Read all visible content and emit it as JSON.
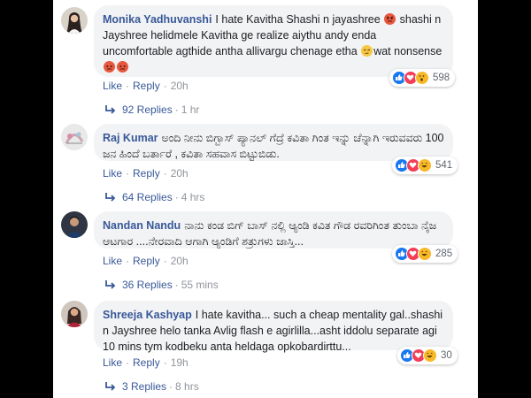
{
  "comments": [
    {
      "author": "Monika Yadhuvanshi",
      "text_parts": [
        "I hate Kavitha Shashi n jayashree",
        " shashi n Jayshree helidmele Kavitha ge realize aiythu andy enda uncomfortable agthide antha allivargu chenage etha",
        "wat nonsense"
      ],
      "like_label": "Like",
      "reply_label": "Reply",
      "time": "20h",
      "reaction_count": "598",
      "replies_label": "92 Replies",
      "replies_time": "1 hr"
    },
    {
      "author": "Raj Kumar",
      "text": "ಅಂದಿ ನೀನು ಬಿಗ್ಬಾಸ್ ಪ್ಯಾನಲ್ ಗೆದ್ರೆ ಕವಿತಾ ಗಿಂತ ಇನ್ನು ಚೆನ್ನಾಗಿ ಇರುವವರು 100 ಜನ ಹಿಂದೆ ಬರ್ತಾರೆ , ಕವಿತಾ ಸಹವಾಸ ಬಿಟ್ಟುಬಿಡು.",
      "like_label": "Like",
      "reply_label": "Reply",
      "time": "20h",
      "reaction_count": "541",
      "replies_label": "64 Replies",
      "replies_time": "4 hrs"
    },
    {
      "author": "Nandan Nandu",
      "text": "ನಾನು ಕಂಡ ಬಿಗ್ ಬಾಸ್ ನಲ್ಲಿ ಆ್ಯಂಡಿ ಕವಿತ ಗೌಡ ರವರಿಗಿಂತ ತುಂಬಾ ನೈಜ ಆಟಗಾರ ....ನೇರವಾದಿ ಆಗಾಗಿ ಆ್ಯಂಡಿಗೆ ಶತ್ರುಗಳು ಜಾಸ್ತಿ...",
      "like_label": "Like",
      "reply_label": "Reply",
      "time": "20h",
      "reaction_count": "285",
      "replies_label": "36 Replies",
      "replies_time": "55 mins"
    },
    {
      "author": "Shreeja Kashyap",
      "text": "I hate kavitha... such a cheap mentality gal..shashi n Jayshree helo tanka Avlig flash e agirlilla...asht iddolu separate agi 10 mins tym kodbeku anta heldaga opkobardirttu...",
      "like_label": "Like",
      "reply_label": "Reply",
      "time": "19h",
      "reaction_count": "30",
      "replies_label": "3 Replies",
      "replies_time": "8 hrs"
    }
  ],
  "colors": {
    "author": "#385898",
    "bubble": "#f2f3f5",
    "meta": "#90949c",
    "like_blue": "#1877f2",
    "love_red": "#f33e58",
    "haha_yellow": "#f7b928"
  },
  "icons": {
    "angry_emoji": "angry-face-emoji",
    "unamused_emoji": "unamused-face-emoji",
    "like": "thumbs-up-icon",
    "love": "heart-icon",
    "wow": "wow-face-icon",
    "haha": "haha-face-icon",
    "reply_arrow": "reply-arrow-icon"
  }
}
